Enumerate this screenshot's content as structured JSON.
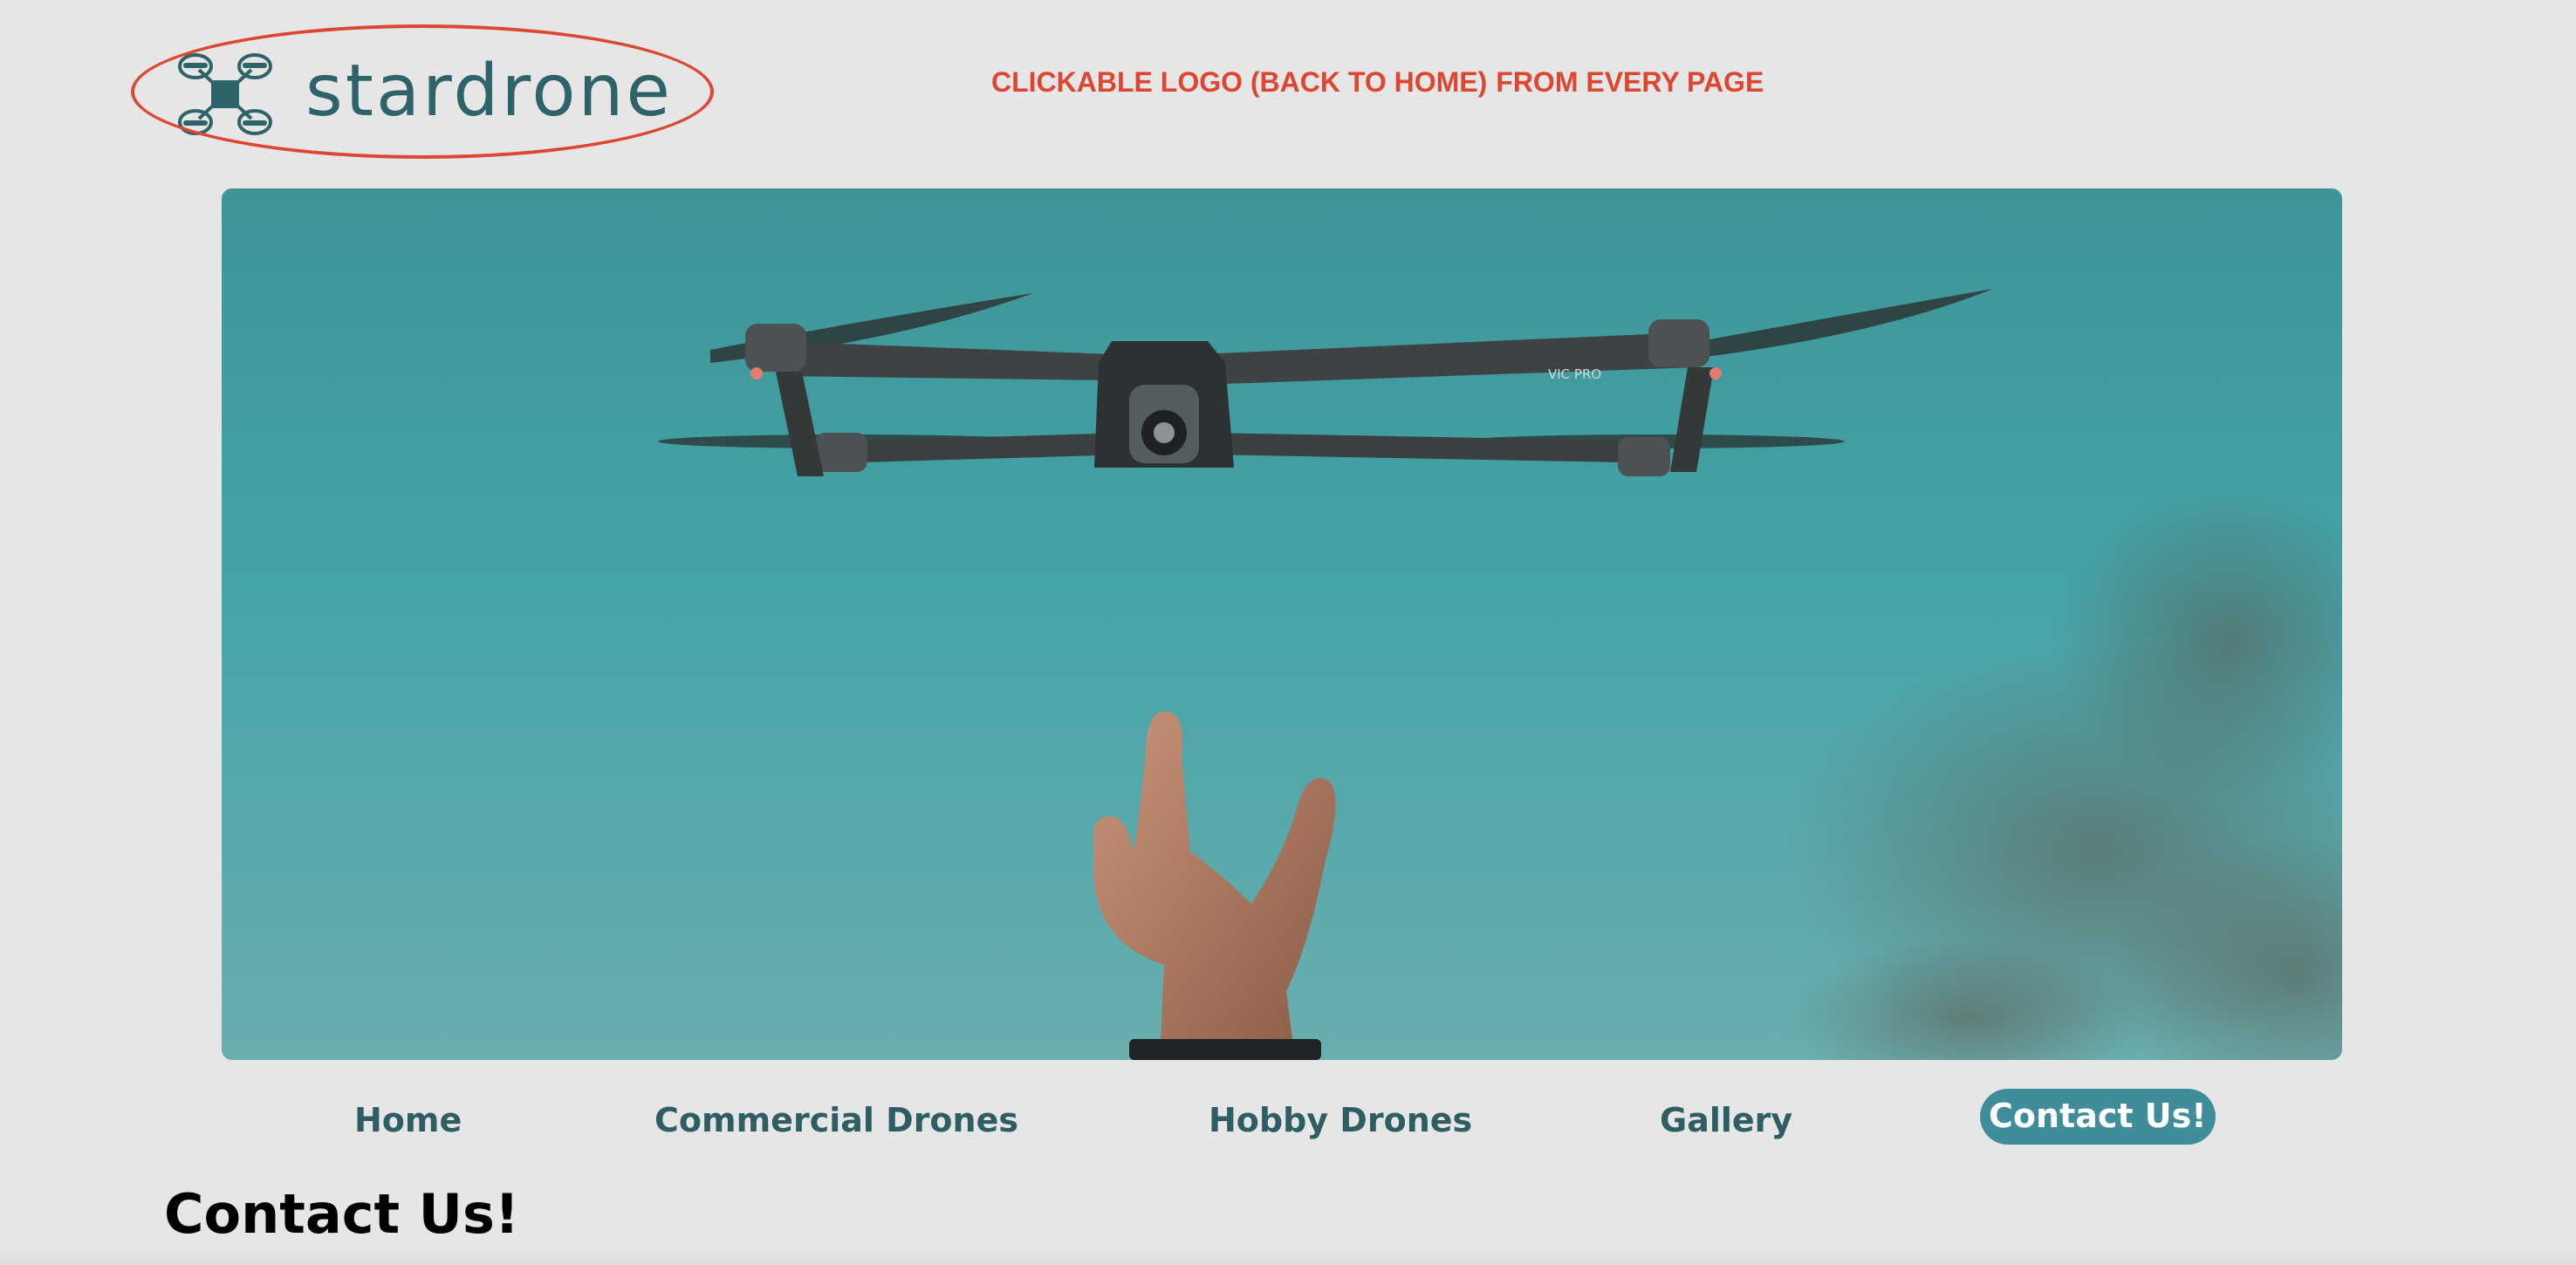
{
  "brand": {
    "name": "stardrone",
    "logo_icon": "drone-icon",
    "color": "#2e6369"
  },
  "annotation": {
    "part1": "CLICKABLE LOGO (BACK TO HOME)",
    "part2": "FROM EVERY PAGE",
    "color": "#dd4630"
  },
  "hero": {
    "drone_label": "VIC PRO"
  },
  "nav": {
    "items": [
      {
        "label": "Home"
      },
      {
        "label": "Commercial Drones"
      },
      {
        "label": "Hobby Drones"
      },
      {
        "label": "Gallery"
      },
      {
        "label": "Contact Us!",
        "active": true
      }
    ],
    "active_bg": "#3f8d9a"
  },
  "page": {
    "title": "Contact Us!"
  }
}
